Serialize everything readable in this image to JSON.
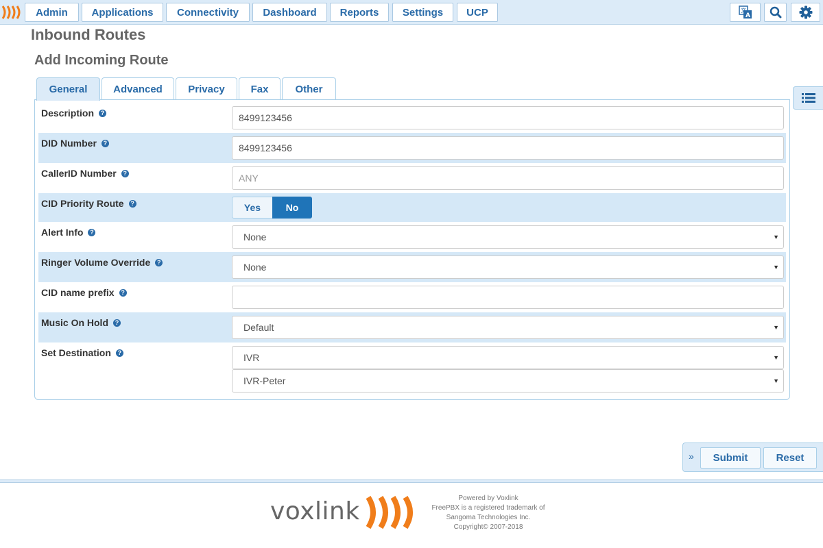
{
  "nav": {
    "items": [
      "Admin",
      "Applications",
      "Connectivity",
      "Dashboard",
      "Reports",
      "Settings",
      "UCP"
    ],
    "icons": [
      "translate-icon",
      "search-icon",
      "gear-icon"
    ]
  },
  "page": {
    "title": "Inbound Routes",
    "subtitle": "Add Incoming Route"
  },
  "tabs": [
    {
      "label": "General",
      "active": true
    },
    {
      "label": "Advanced",
      "active": false
    },
    {
      "label": "Privacy",
      "active": false
    },
    {
      "label": "Fax",
      "active": false
    },
    {
      "label": "Other",
      "active": false
    }
  ],
  "form": {
    "description": {
      "label": "Description",
      "value": "8499123456"
    },
    "did_number": {
      "label": "DID Number",
      "value": "8499123456"
    },
    "callerid_number": {
      "label": "CallerID Number",
      "value": "",
      "placeholder": "ANY"
    },
    "cid_priority_route": {
      "label": "CID Priority Route",
      "options": [
        "Yes",
        "No"
      ],
      "selected": "No"
    },
    "alert_info": {
      "label": "Alert Info",
      "value": "None"
    },
    "ringer_volume_override": {
      "label": "Ringer Volume Override",
      "value": "None"
    },
    "cid_name_prefix": {
      "label": "CID name prefix",
      "value": ""
    },
    "music_on_hold": {
      "label": "Music On Hold",
      "value": "Default"
    },
    "set_destination": {
      "label": "Set Destination",
      "type_value": "IVR",
      "target_value": "IVR-Peter"
    }
  },
  "actions": {
    "submit": "Submit",
    "reset": "Reset"
  },
  "footer": {
    "brand": "voxlink",
    "lines": [
      "Powered by Voxlink",
      "FreePBX is a registered trademark of",
      "Sangoma Technologies Inc.",
      "Copyright© 2007-2018"
    ]
  },
  "colors": {
    "accent": "#2a6ba8",
    "nav_bg": "#dcebf8",
    "row_shade": "#d5e8f7",
    "toggle_active": "#1f74b8",
    "brand_orange": "#f07d1a"
  }
}
